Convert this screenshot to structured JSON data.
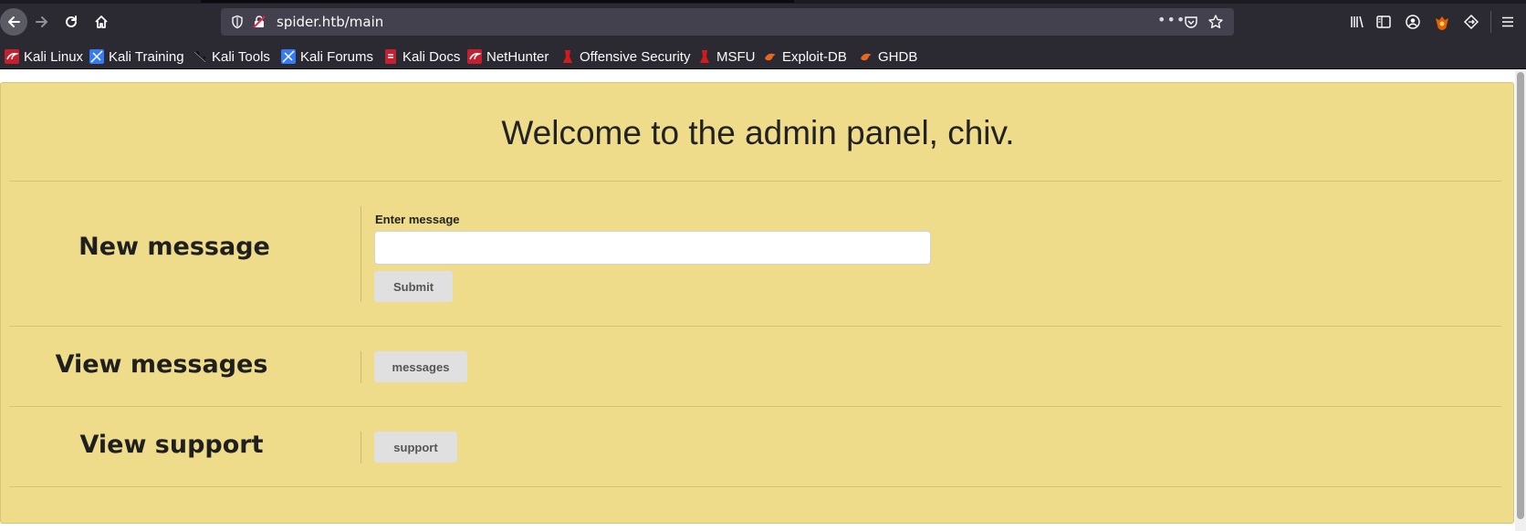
{
  "browser": {
    "url": "spider.htb/main",
    "bookmarks": [
      {
        "label": "Kali Linux",
        "icon": "kali-dragon-icon"
      },
      {
        "label": "Kali Training",
        "icon": "kali-training-icon"
      },
      {
        "label": "Kali Tools",
        "icon": "kali-tools-icon"
      },
      {
        "label": "Kali Forums",
        "icon": "kali-forums-icon"
      },
      {
        "label": "Kali Docs",
        "icon": "kali-docs-icon"
      },
      {
        "label": "NetHunter",
        "icon": "nethunter-icon"
      },
      {
        "label": "Offensive Security",
        "icon": "offsec-icon"
      },
      {
        "label": "MSFU",
        "icon": "msfu-icon"
      },
      {
        "label": "Exploit-DB",
        "icon": "exploit-db-icon"
      },
      {
        "label": "GHDB",
        "icon": "ghdb-icon"
      }
    ]
  },
  "page": {
    "welcome": "Welcome to the admin panel, chiv.",
    "new_message": {
      "title": "New message",
      "label": "Enter message",
      "input_value": "",
      "submit_label": "Submit"
    },
    "view_messages": {
      "title": "View messages",
      "button_label": "messages"
    },
    "view_support": {
      "title": "View support",
      "button_label": "support"
    }
  },
  "colors": {
    "panel_bg": "#eedc8a",
    "chrome_bg": "#2b2a33",
    "button_bg": "#e0e0e0"
  }
}
